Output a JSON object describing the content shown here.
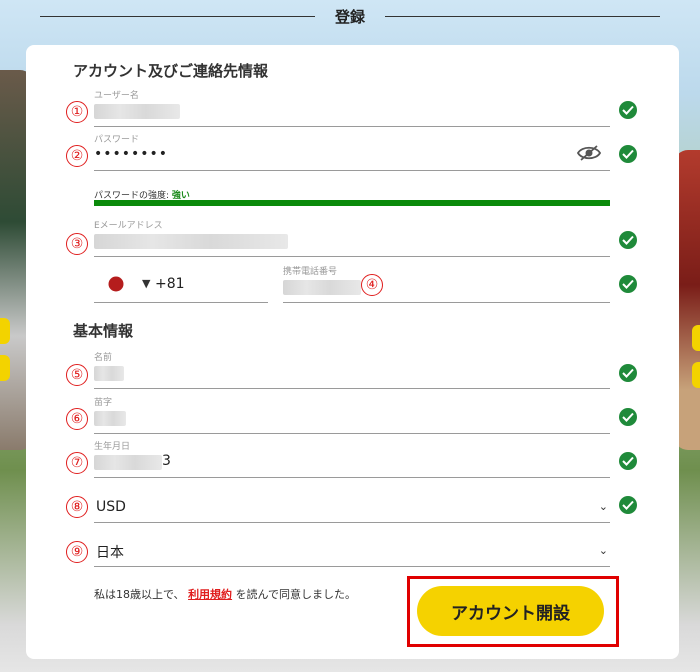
{
  "page_title": "登録",
  "sections": {
    "account": "アカウント及びご連絡先情報",
    "basic": "基本情報"
  },
  "fields": {
    "username": {
      "label": "ユーザー名",
      "number": "①"
    },
    "password": {
      "label": "パスワード",
      "value": "••••••••",
      "number": "②"
    },
    "password_strength": {
      "label": "パスワードの強度:",
      "value": "強い",
      "level": 1.0
    },
    "email": {
      "label": "Eメールアドレス",
      "number": "③"
    },
    "phone": {
      "country_code": "+81",
      "label": "携帯電話番号",
      "number": "④"
    },
    "first_name": {
      "label": "名前",
      "number": "⑤"
    },
    "last_name": {
      "label": "苗字",
      "number": "⑥"
    },
    "birthdate": {
      "label": "生年月日",
      "number": "⑦",
      "visible_tail": "3"
    },
    "currency": {
      "value": "USD",
      "number": "⑧"
    },
    "country": {
      "value": "日本",
      "number": "⑨"
    }
  },
  "consent": {
    "prefix": "私は18歳以上で、",
    "link": "利用規約",
    "suffix": "を読んで同意しました。"
  },
  "submit_label": "アカウント開設",
  "colors": {
    "accent": "#f5d200",
    "check": "#1f8a3a",
    "annotation": "#e01e1e",
    "strength": "#0b8a0b"
  },
  "icons": {
    "valid": "check-circle-icon",
    "hide_password": "eye-slash-icon",
    "flag": "japan-flag-icon",
    "dropdown": "chevron-down-icon"
  }
}
